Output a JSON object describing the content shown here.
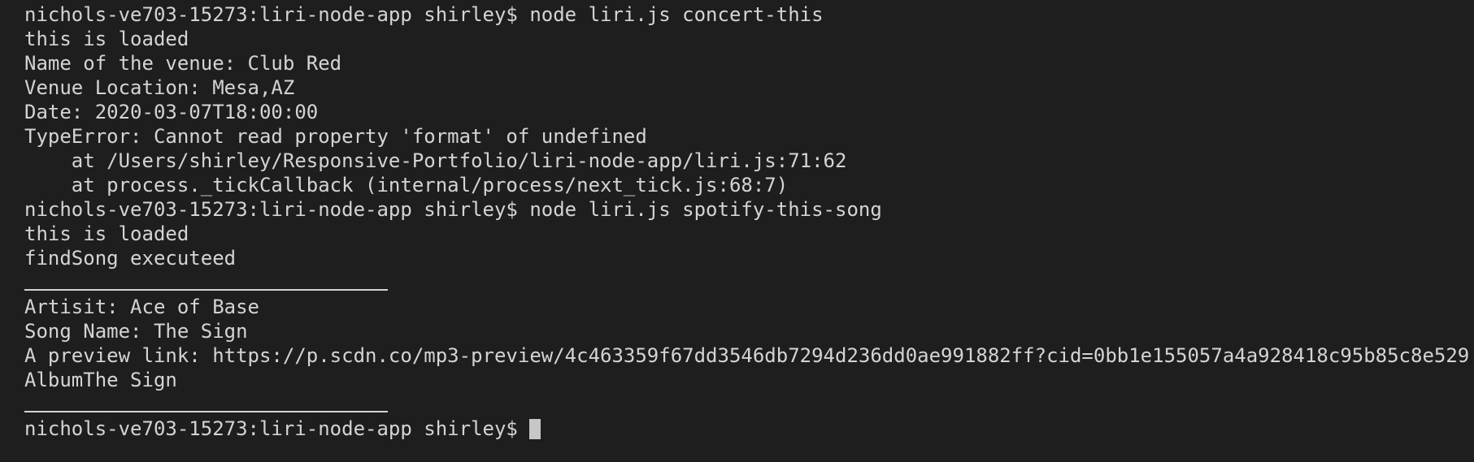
{
  "terminal": {
    "lines": {
      "cmd1": "nichols-ve703-15273:liri-node-app shirley$ node liri.js concert-this",
      "out1": "this is loaded",
      "venue_name": "Name of the venue: Club Red",
      "venue_location": "Venue Location: Mesa,AZ",
      "date": "Date: 2020-03-07T18:00:00",
      "error": "TypeError: Cannot read property 'format' of undefined",
      "stack1": "    at /Users/shirley/Responsive-Portfolio/liri-node-app/liri.js:71:62",
      "stack2": "    at process._tickCallback (internal/process/next_tick.js:68:7)",
      "cmd2": "nichols-ve703-15273:liri-node-app shirley$ node liri.js spotify-this-song",
      "out2": "this is loaded",
      "out3": "findSong executeed",
      "artist": "Artisit: Ace of Base",
      "song_name": "Song Name: The Sign",
      "preview_link": "A preview link: https://p.scdn.co/mp3-preview/4c463359f67dd3546db7294d236dd0ae991882ff?cid=0bb1e155057a4a928418c95b85c8e529",
      "album": "AlbumThe Sign",
      "prompt": "nichols-ve703-15273:liri-node-app shirley$"
    }
  }
}
